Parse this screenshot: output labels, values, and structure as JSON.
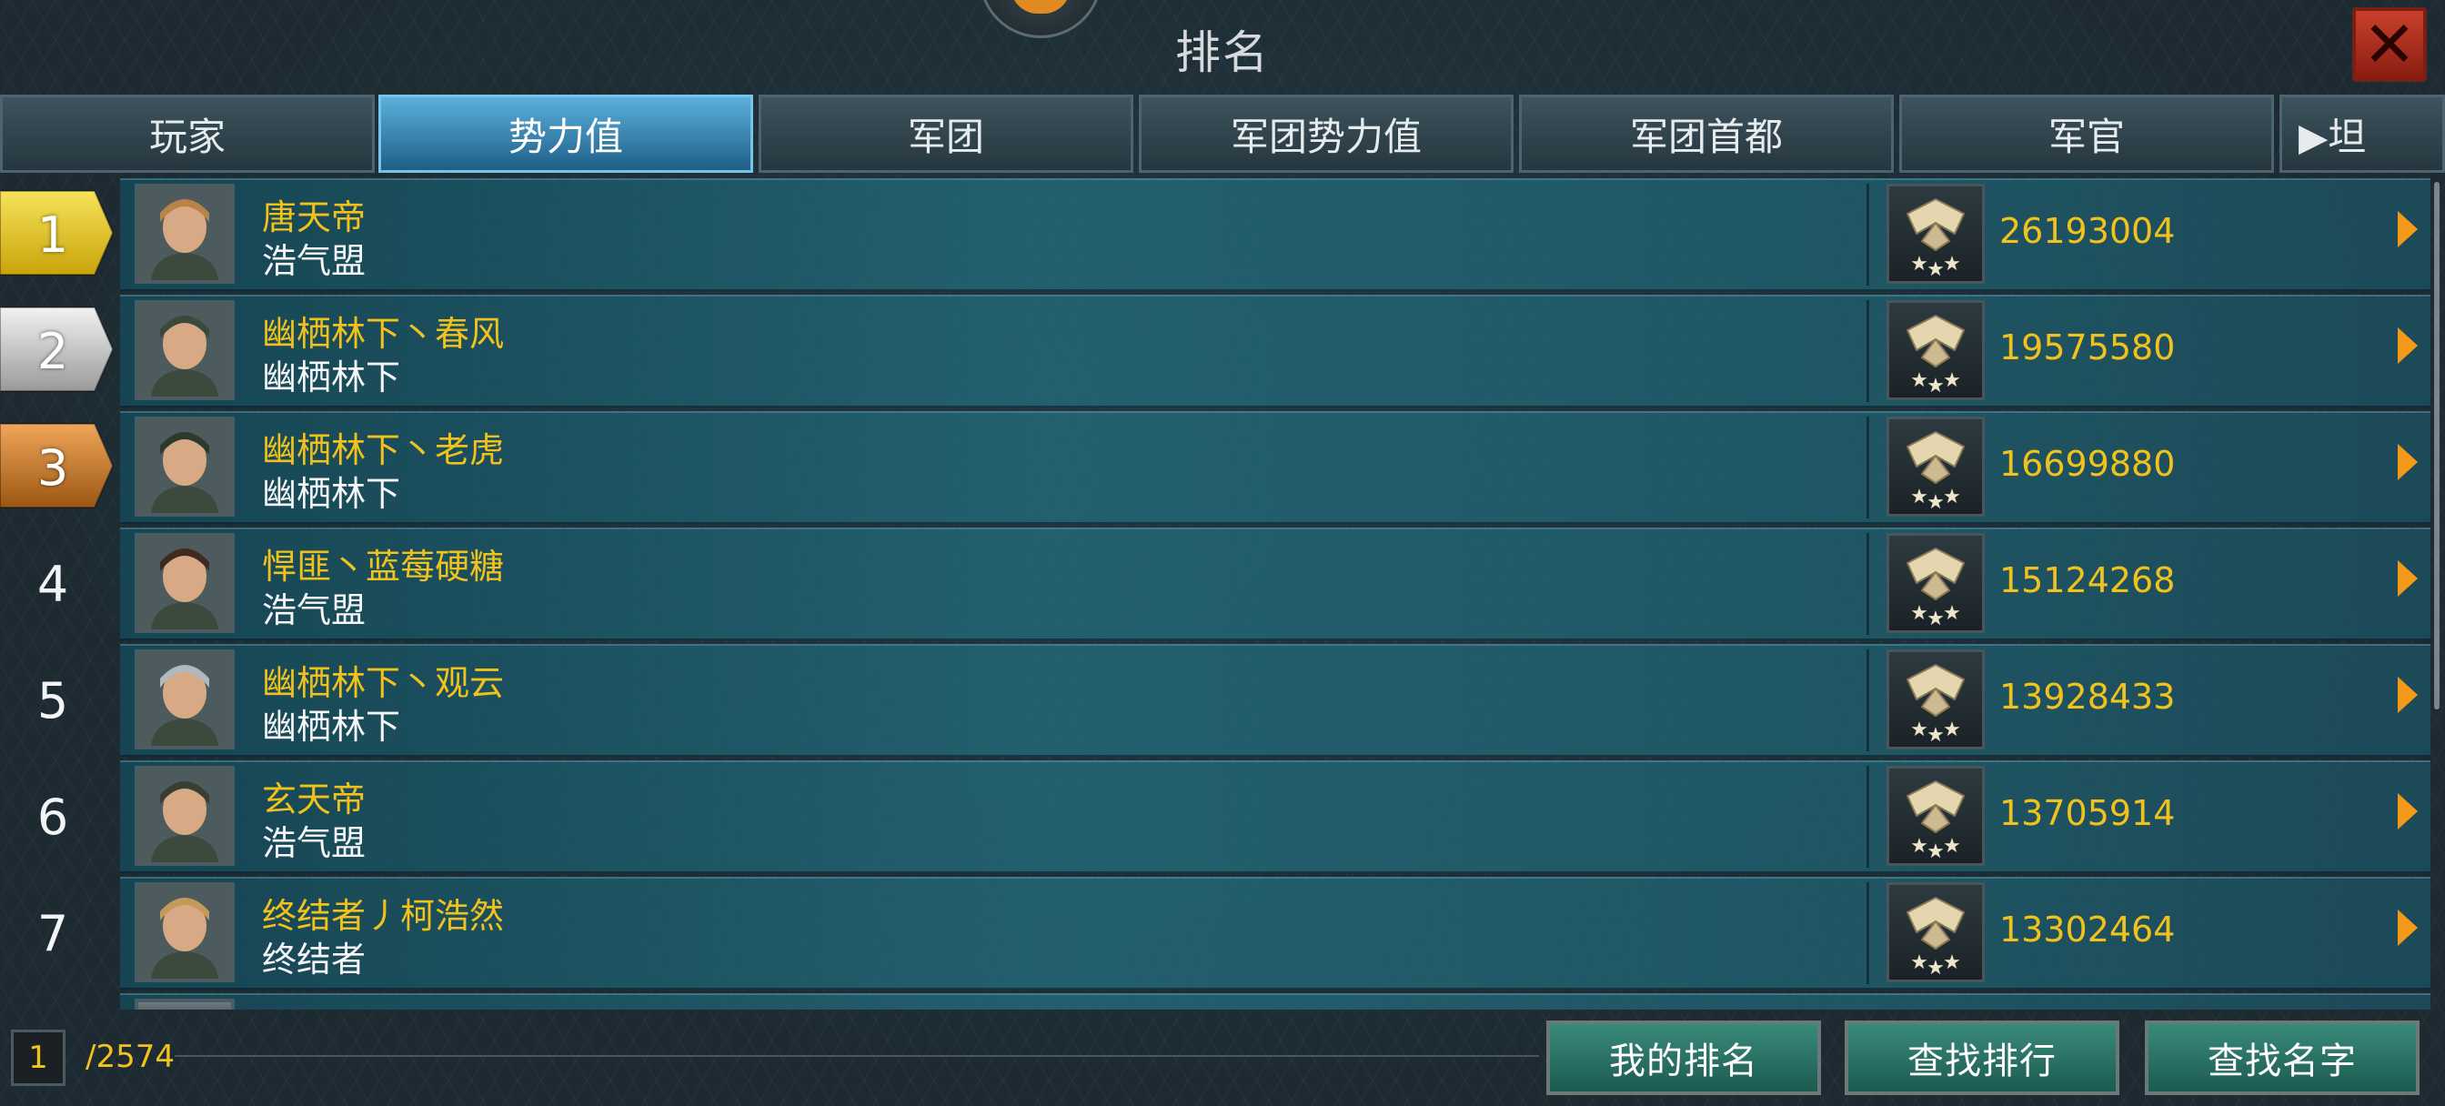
{
  "title": "排名",
  "tabs": [
    {
      "label": "玩家",
      "active": false
    },
    {
      "label": "势力值",
      "active": true
    },
    {
      "label": "军团",
      "active": false
    },
    {
      "label": "军团势力值",
      "active": false
    },
    {
      "label": "军团首都",
      "active": false
    },
    {
      "label": "军官",
      "active": false
    },
    {
      "label": "▶坦",
      "active": false
    }
  ],
  "rows": [
    {
      "rank": "1",
      "name": "唐天帝",
      "clan": "浩气盟",
      "power": "26193004",
      "medal": "gold"
    },
    {
      "rank": "2",
      "name": "幽栖林下丶春风",
      "clan": "幽栖林下",
      "power": "19575580",
      "medal": "silver"
    },
    {
      "rank": "3",
      "name": "幽栖林下丶老虎",
      "clan": "幽栖林下",
      "power": "16699880",
      "medal": "bronze"
    },
    {
      "rank": "4",
      "name": "悍匪丶蓝莓硬糖",
      "clan": "浩气盟",
      "power": "15124268",
      "medal": ""
    },
    {
      "rank": "5",
      "name": "幽栖林下丶观云",
      "clan": "幽栖林下",
      "power": "13928433",
      "medal": ""
    },
    {
      "rank": "6",
      "name": "玄天帝",
      "clan": "浩气盟",
      "power": "13705914",
      "medal": ""
    },
    {
      "rank": "7",
      "name": "终结者丿柯浩然",
      "clan": "终结者",
      "power": "13302464",
      "medal": ""
    }
  ],
  "footer": {
    "page": "1",
    "total": "/2574",
    "my_rank": "我的排名",
    "find_rank": "查找排行",
    "find_name": "查找名字"
  },
  "colors": {
    "gold_text": "#f2c21c",
    "active_tab": "#4a9fd0",
    "close": "#b8321f",
    "arrow": "#f59a18"
  }
}
